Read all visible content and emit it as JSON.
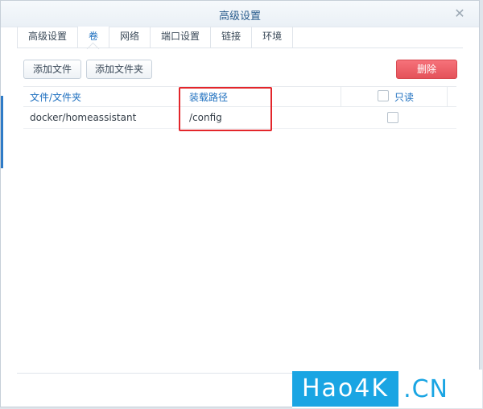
{
  "window": {
    "title": "高级设置",
    "close_glyph": "✕"
  },
  "tabs": [
    {
      "label": "高级设置",
      "active": false
    },
    {
      "label": "卷",
      "active": true
    },
    {
      "label": "网络",
      "active": false
    },
    {
      "label": "端口设置",
      "active": false
    },
    {
      "label": "链接",
      "active": false
    },
    {
      "label": "环境",
      "active": false
    }
  ],
  "toolbar": {
    "add_file_label": "添加文件",
    "add_folder_label": "添加文件夹",
    "delete_label": "删除"
  },
  "table": {
    "columns": {
      "file": "文件/文件夹",
      "mount_path": "装载路径",
      "readonly": "只读"
    },
    "rows": [
      {
        "file": "docker/homeassistant",
        "mount_path": "/config",
        "readonly": false
      }
    ]
  },
  "watermark": {
    "main": "Hao4K",
    "suffix": ".CN"
  },
  "colors": {
    "accent": "#1d6fbf",
    "delete": "#e4525a",
    "highlight": "#e3262b",
    "watermark": "#1aa5e3"
  }
}
